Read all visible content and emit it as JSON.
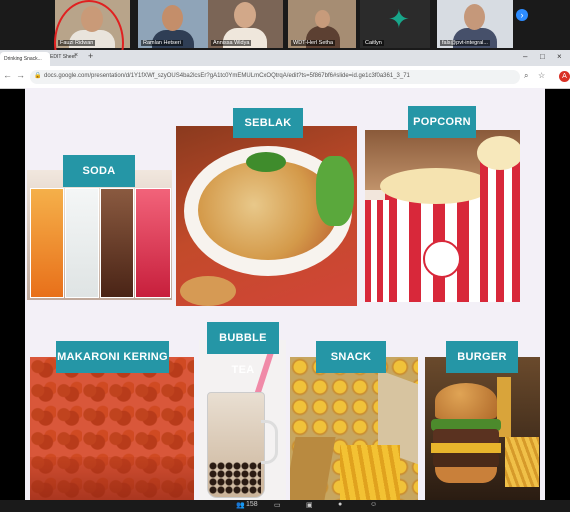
{
  "meeting": {
    "participants": [
      "Fauzi Ridwan",
      "Ramlan Hetseri",
      "Annissa Widya",
      "WDT-Herl Setha",
      "Caitlyn",
      "fals@pvt-integral..."
    ],
    "next_icon": "chevron-right-icon"
  },
  "browser": {
    "tab_title": "Drinking Snack...",
    "tab2_title": "EDIT Sheet",
    "url": "docs.google.com/presentation/d/1Y1fXWf_szyOUS4ba2lcsEr?gA1tc0YmEMULmCxOQtrqA/edit?ts=5f867bf6#slide=id.ge1c3f0a361_3_71",
    "profile_initial": "A"
  },
  "slide": {
    "labels": {
      "soda": "SODA",
      "seblak": "SEBLAK",
      "popcorn": "POPCORN",
      "makaroni": "MAKARONI KERING",
      "bubble_tea": "BUBBLE TEA",
      "snack": "SNACK",
      "burger": "BURGER"
    },
    "accent_color": "#2596a6"
  },
  "taskbar": {
    "count": "158"
  }
}
